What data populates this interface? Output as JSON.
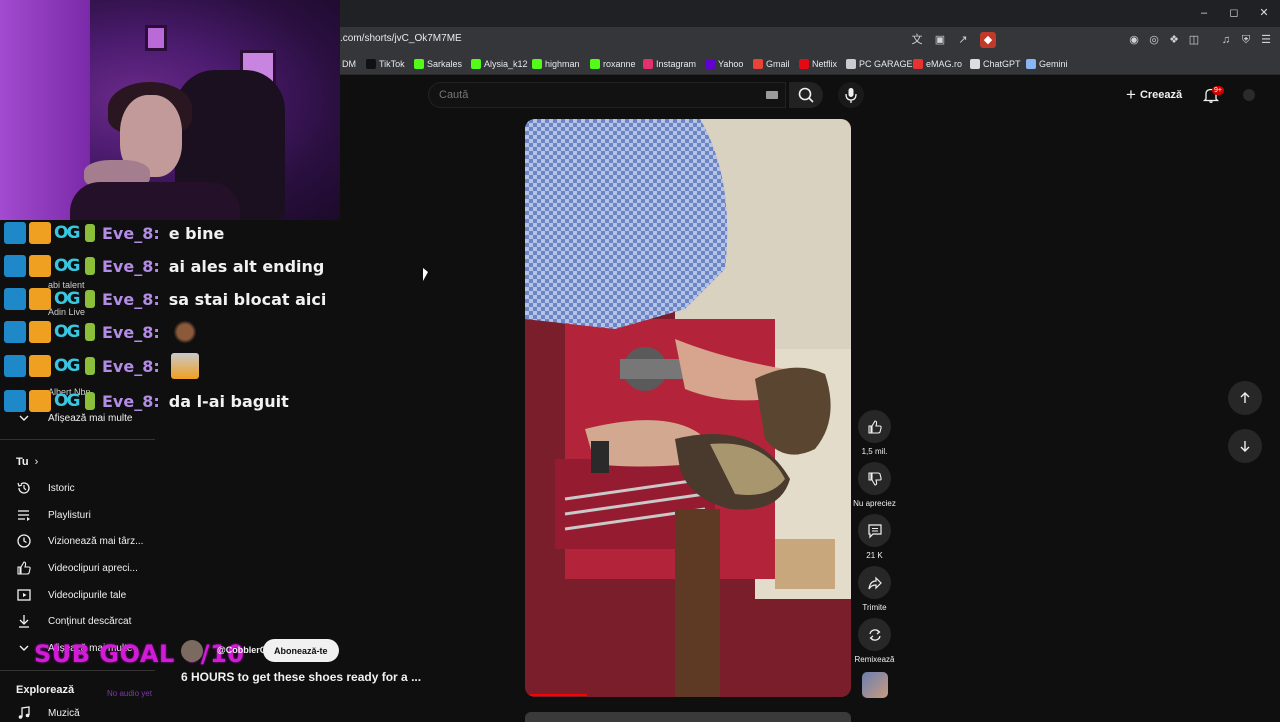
{
  "browser": {
    "url": ".com/shorts/jvC_Ok7M7ME",
    "bookmarks": [
      {
        "label": "DM",
        "icon": "bookmark-dm-icon",
        "color": "#555555"
      },
      {
        "label": "TikTok",
        "icon": "tiktok-icon",
        "color": "#111111"
      },
      {
        "label": "Sarkales",
        "icon": "kick-icon",
        "color": "#53fc18"
      },
      {
        "label": "Alysia_k12",
        "icon": "kick-icon",
        "color": "#53fc18"
      },
      {
        "label": "highman",
        "icon": "kick-icon",
        "color": "#53fc18"
      },
      {
        "label": "roxanne",
        "icon": "kick-icon",
        "color": "#53fc18"
      },
      {
        "label": "Instagram",
        "icon": "instagram-icon",
        "color": "#e1306c"
      },
      {
        "label": "Yahoo",
        "icon": "yahoo-icon",
        "color": "#6001d2"
      },
      {
        "label": "Gmail",
        "icon": "gmail-icon",
        "color": "#ea4335"
      },
      {
        "label": "Netflix",
        "icon": "netflix-icon",
        "color": "#e50914"
      },
      {
        "label": "PC GARAGE",
        "icon": "pcgarage-icon",
        "color": "#cccccc"
      },
      {
        "label": "eMAG.ro",
        "icon": "emag-icon",
        "color": "#e8322f"
      },
      {
        "label": "ChatGPT",
        "icon": "chatgpt-icon",
        "color": "#dddddd"
      },
      {
        "label": "Gemini",
        "icon": "gemini-icon",
        "color": "#8ab4f8"
      }
    ]
  },
  "header": {
    "search_placeholder": "Caută",
    "create_label": "Creează",
    "notification_badge": "9+"
  },
  "chat": [
    {
      "user": "Eve_8:",
      "message": "e bine"
    },
    {
      "user": "Eve_8:",
      "message": "ai ales alt ending"
    },
    {
      "user": "Eve_8:",
      "message": "sa stai blocat aici"
    },
    {
      "user": "Eve_8:",
      "message": "",
      "emote": "monkey-emote"
    },
    {
      "user": "Eve_8:",
      "message": "",
      "emote": "astronaut-emote"
    },
    {
      "user": "Eve_8:",
      "message": "da l-ai baguit"
    }
  ],
  "sidebar": {
    "hidden_subscriptions": [
      "abi talent",
      "Adin Live",
      "Albert Nbn"
    ],
    "show_more_label": "Afișează mai multe",
    "you_label": "Tu",
    "you_items": [
      {
        "label": "Istoric",
        "icon": "history-icon"
      },
      {
        "label": "Playlisturi",
        "icon": "playlist-icon"
      },
      {
        "label": "Vizionează mai târz...",
        "icon": "clock-icon"
      },
      {
        "label": "Videoclipuri apreci...",
        "icon": "thumb-up-icon"
      },
      {
        "label": "Videoclipurile tale",
        "icon": "play-square-icon"
      },
      {
        "label": "Conținut descărcat",
        "icon": "download-icon"
      }
    ],
    "show_more_label_2": "Afișează mai multe",
    "explore_label": "Explorează",
    "explore_items": [
      {
        "label": "Muzică",
        "icon": "music-icon"
      }
    ]
  },
  "overlay": {
    "sub_goal": "SUB GOAL 0/10",
    "no_audio": "No audio yet"
  },
  "video": {
    "channel": "@CobblerG",
    "subscribe_label": "Abonează-te",
    "title": "6 HOURS to get these shoes ready for a ...",
    "progress_fraction": 0.18
  },
  "actions": {
    "likes": "1,5 mil.",
    "dislike_label": "Nu apreciez",
    "comments": "21 K",
    "share_label": "Trimite",
    "remix_label": "Remixează"
  },
  "colors": {
    "background": "#0f0f0f",
    "chat_username": "#b38ce6",
    "sub_goal": "#d21ad8",
    "youtube_red": "#ff0000"
  }
}
